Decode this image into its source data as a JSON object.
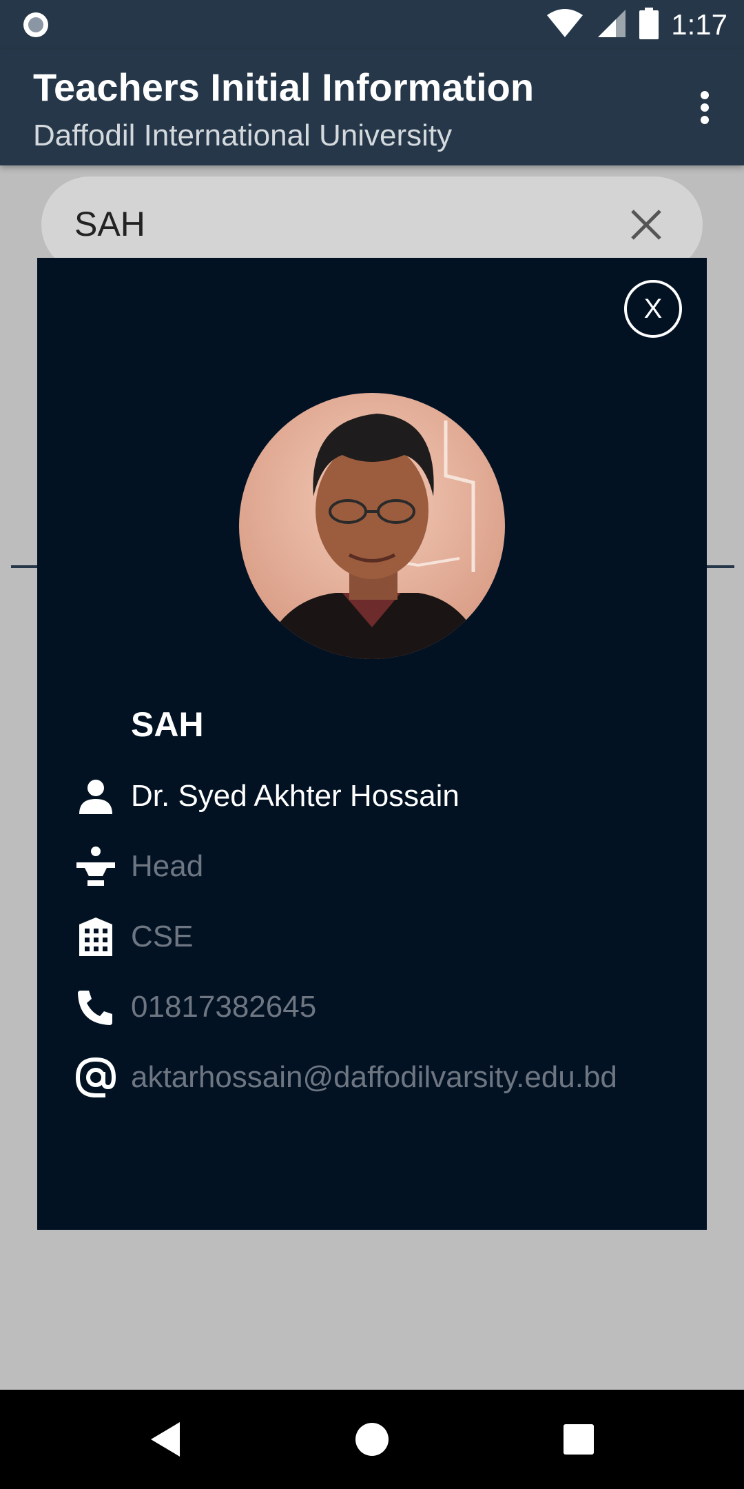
{
  "status_bar": {
    "time": "1:17",
    "icons": [
      "notification-circle-icon",
      "wifi-icon",
      "signal-icon",
      "battery-icon"
    ]
  },
  "app_bar": {
    "title": "Teachers Initial Information",
    "subtitle": "Daffodil International University",
    "menu_icon": "overflow-menu-icon"
  },
  "search": {
    "value": "SAH",
    "clear_icon": "close-icon"
  },
  "dialog": {
    "close_label": "X",
    "avatar_alt": "teacher-photo",
    "short_code": "SAH",
    "rows": [
      {
        "icon": "person-icon",
        "text": "Dr. Syed Akhter Hossain"
      },
      {
        "icon": "designation-icon",
        "text": "Head"
      },
      {
        "icon": "building-icon",
        "text": "CSE"
      },
      {
        "icon": "phone-icon",
        "text": "01817382645"
      },
      {
        "icon": "at-sign-icon",
        "text": "aktarhossain@daffodilvarsity.edu.bd"
      }
    ]
  },
  "nav_bar": {
    "icons": [
      "back-icon",
      "home-icon",
      "recents-icon"
    ]
  },
  "colors": {
    "app_bar": "#253748",
    "dialog_bg": "#021223",
    "scrim": "#bdbdbd",
    "secondary_text": "#6e7682"
  }
}
